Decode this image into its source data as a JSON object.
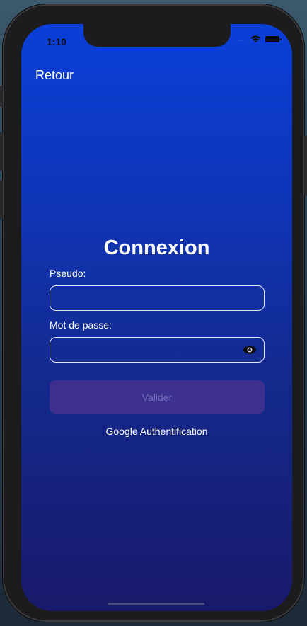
{
  "status_bar": {
    "time": "1:10",
    "signal": "....",
    "wifi_icon": "wifi-icon",
    "battery_icon": "battery-icon"
  },
  "nav": {
    "back_label": "Retour"
  },
  "login": {
    "title": "Connexion",
    "username_label": "Pseudo:",
    "username_value": "",
    "password_label": "Mot de passe:",
    "password_value": "",
    "password_toggle_icon": "eye-icon",
    "submit_label": "Valider",
    "google_label": "Google Authentification"
  },
  "colors": {
    "screen_top": "#0a3fd8",
    "screen_bottom": "#18196a",
    "submit_bg": "#3d2f8e",
    "submit_text": "#6c6fb4",
    "field_border": "#e4e8ff"
  }
}
